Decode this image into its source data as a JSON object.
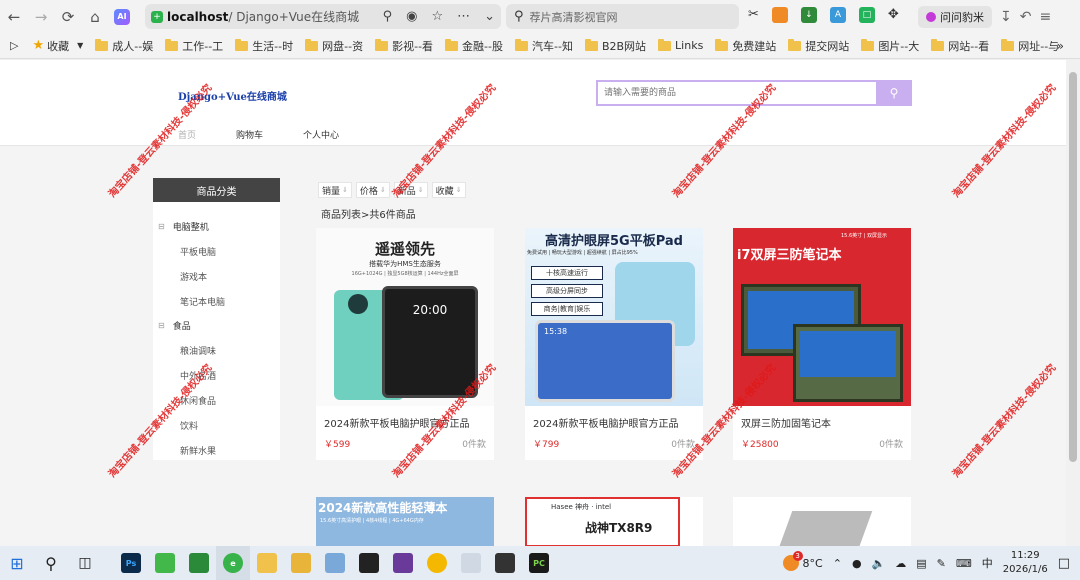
{
  "browser": {
    "url_host": "localhost",
    "url_rest": " / Django+Vue在线商城",
    "search_placeholder": "荐片高清影视官网",
    "ask_button": "问问豹米",
    "ai_badge": "AI"
  },
  "bookmarks": [
    {
      "label": "收藏",
      "icon": "star-icon"
    },
    {
      "label": "成人--娱"
    },
    {
      "label": "工作--工"
    },
    {
      "label": "生活--时"
    },
    {
      "label": "网盘--资"
    },
    {
      "label": "影视--看"
    },
    {
      "label": "金融--股"
    },
    {
      "label": "汽车--知"
    },
    {
      "label": "B2B网站"
    },
    {
      "label": "Links"
    },
    {
      "label": "免费建站"
    },
    {
      "label": "提交网站"
    },
    {
      "label": "图片--大"
    },
    {
      "label": "网站--看"
    },
    {
      "label": "网址--与"
    }
  ],
  "site": {
    "logo": "Django+Vue在线商城",
    "search_placeholder": "请输入需要的商品",
    "nav": [
      "首页",
      "购物车",
      "个人中心"
    ]
  },
  "sidebar": {
    "title": "商品分类",
    "categories": [
      {
        "name": "电脑整机",
        "children": [
          "平板电脑",
          "游戏本",
          "笔记本电脑"
        ]
      },
      {
        "name": "食品",
        "children": [
          "粮油调味",
          "中外名酒",
          "休闲食品",
          "饮料",
          "新鲜水果"
        ]
      }
    ]
  },
  "sort": [
    "销量",
    "价格",
    "新品",
    "收藏"
  ],
  "list_title": "商品列表>共6件商品",
  "products": [
    {
      "name": "2024新款平板电脑护眼官方正品",
      "price": "￥599",
      "sales": "0件款",
      "img_text": "遥遥领先",
      "img_sub": "搭载华为HMS生态服务",
      "img_spec": "16G+1024G | 独显5G8核运算 | 144Hz全面屏",
      "img_time": "20:00"
    },
    {
      "name": "2024新款平板电脑护眼官方正品",
      "price": "￥799",
      "sales": "0件款",
      "img_text": "高清护眼屏5G平板Pad",
      "img_sub": "免费试用 | 畅玩大型游戏 | 超强续航 | 屏占比95%",
      "img_tags": [
        "十核高速运行",
        "高级分屏同步",
        "商务|教育|娱乐"
      ],
      "img_time": "15:38"
    },
    {
      "name": "双屏三防加固笔记本",
      "price": "￥25800",
      "sales": "0件款",
      "img_text": "i7双屏三防笔记本",
      "img_badge": "15.6英寸 | 双屏显示"
    }
  ],
  "bottom_products": [
    {
      "img_text": "2024新款高性能轻薄本",
      "img_sub": "15.6英寸高清护眼 | 4核4线程 | 4G+64G内存"
    },
    {
      "img_text": "战神TX8R9",
      "img_brand": "Hasee 神舟 · intel"
    },
    {
      "img_text": ""
    }
  ],
  "watermark": "淘宝店铺-登云素材科技-侵权必究",
  "taskbar": {
    "weather": "8°C",
    "weather_badge": "3",
    "ime": "中",
    "time": "11:29",
    "date": "2026/1/6"
  },
  "colors": {
    "accent_purple": "#c9aef0",
    "price_red": "#e02828",
    "sidebar_head": "#444444",
    "logo_blue": "#1a3fa8"
  }
}
